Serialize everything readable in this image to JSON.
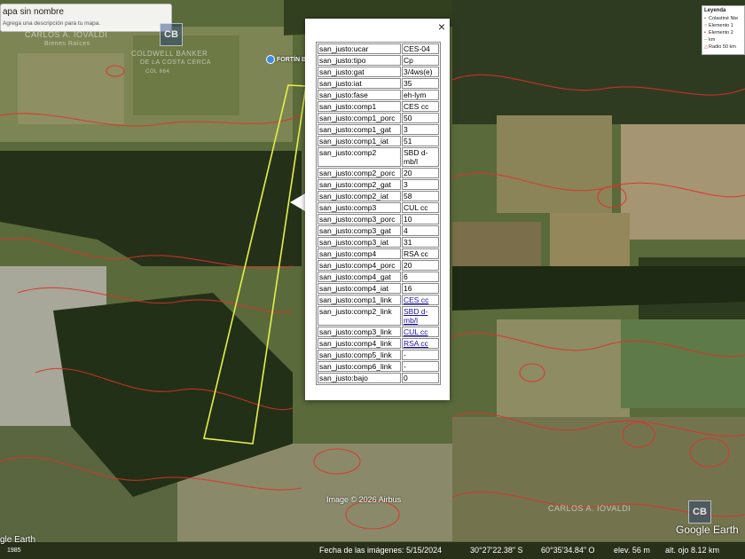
{
  "map": {
    "title": "apa sin nombre",
    "description": "Agrega una descripción para tu mapa.",
    "watermarks": [
      "CARLOS A. IOVALDI",
      "Bienes Raíces",
      "COLDWELL BANKER",
      "DE LA COSTA CERCA",
      "COL 664",
      "CARLOS A. IOVALDI"
    ],
    "logo_text": "CB",
    "pin_label": "FORTÍN B",
    "imagery_credit": "Image © 2026 Airbus"
  },
  "legend": {
    "title": "Leyenda",
    "items": [
      {
        "label": "Colastiné Nte",
        "icon": "pin-icon"
      },
      {
        "label": "Elemento 1",
        "icon": "circle-icon"
      },
      {
        "label": "Elemento 2",
        "icon": "bulb-icon"
      },
      {
        "label": "km",
        "icon": "ruler-icon"
      },
      {
        "label": "Radio 50 km",
        "icon": "triangle-icon"
      }
    ]
  },
  "popup": {
    "close_label": "×",
    "rows": [
      {
        "key": "san_justo:ucar",
        "value": "CES-04"
      },
      {
        "key": "san_justo:tipo",
        "value": "Cp"
      },
      {
        "key": "san_justo:gat",
        "value": "3/4ws(e)"
      },
      {
        "key": "san_justo:iat",
        "value": "35"
      },
      {
        "key": "san_justo:fase",
        "value": "eh-lym"
      },
      {
        "key": "san_justo:comp1",
        "value": "CES cc"
      },
      {
        "key": "san_justo:comp1_porc",
        "value": "50"
      },
      {
        "key": "san_justo:comp1_gat",
        "value": "3"
      },
      {
        "key": "san_justo:comp1_iat",
        "value": "51"
      },
      {
        "key": "san_justo:comp2",
        "value": "SBD d-mb/l"
      },
      {
        "key": "san_justo:comp2_porc",
        "value": "20"
      },
      {
        "key": "san_justo:comp2_gat",
        "value": "3"
      },
      {
        "key": "san_justo:comp2_iat",
        "value": "58"
      },
      {
        "key": "san_justo:comp3",
        "value": "CUL cc"
      },
      {
        "key": "san_justo:comp3_porc",
        "value": "10"
      },
      {
        "key": "san_justo:comp3_gat",
        "value": "4"
      },
      {
        "key": "san_justo:comp3_iat",
        "value": "31"
      },
      {
        "key": "san_justo:comp4",
        "value": "RSA cc"
      },
      {
        "key": "san_justo:comp4_porc",
        "value": "20"
      },
      {
        "key": "san_justo:comp4_gat",
        "value": "6"
      },
      {
        "key": "san_justo:comp4_iat",
        "value": "16"
      },
      {
        "key": "san_justo:comp1_link",
        "value": "CES cc",
        "link": true
      },
      {
        "key": "san_justo:comp2_link",
        "value": "SBD d-mb/l",
        "link": true
      },
      {
        "key": "san_justo:comp3_link",
        "value": "CUL cc",
        "link": true
      },
      {
        "key": "san_justo:comp4_link",
        "value": "RSA cc",
        "link": true
      },
      {
        "key": "san_justo:comp5_link",
        "value": "-"
      },
      {
        "key": "san_justo:comp6_link",
        "value": "-"
      },
      {
        "key": "san_justo:bajo",
        "value": "0"
      }
    ]
  },
  "status": {
    "logo_left": "gle Earth",
    "logo_right": "Google Earth",
    "year": "1985",
    "imagery_date": "Fecha de las imágenes: 5/15/2024",
    "lat": "30°27'22.38\" S",
    "lon": "60°35'34.84\" O",
    "elev": "elev.   56 m",
    "eye_alt": "alt. ojo   8.12 km"
  },
  "colors": {
    "soil_contour": "#e0302a",
    "parcel_outline": "#e6f04a",
    "pin": "#3b8de0"
  }
}
